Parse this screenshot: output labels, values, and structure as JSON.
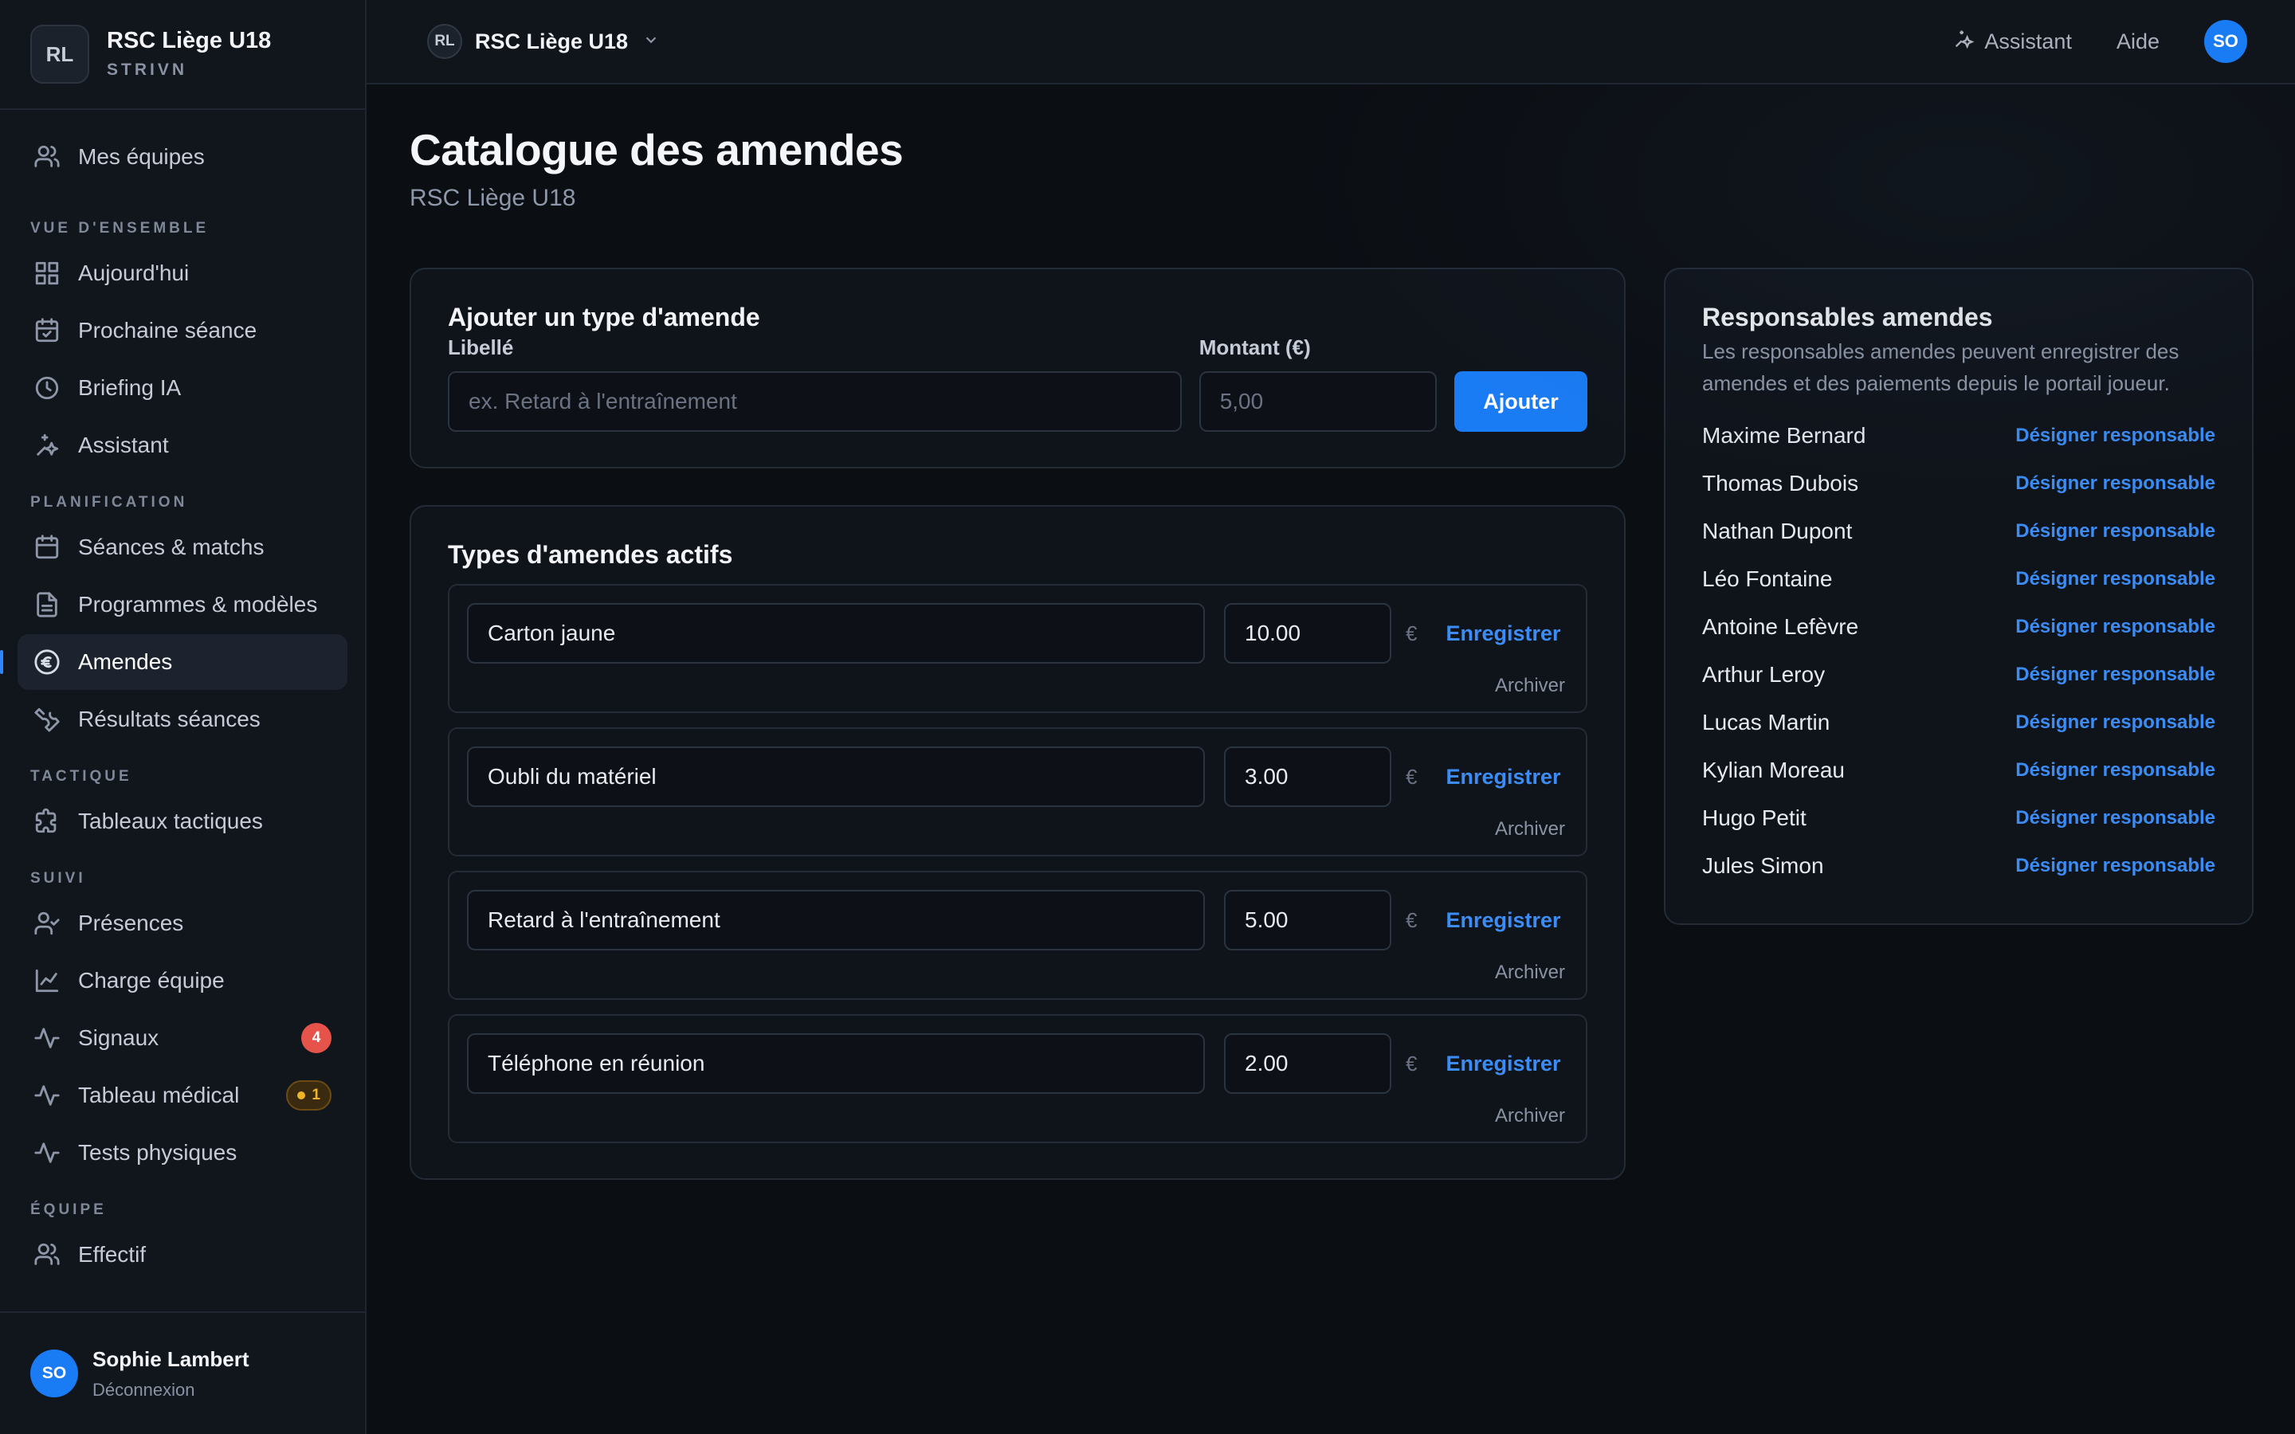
{
  "brand": {
    "initials": "RL",
    "name": "RSC Liège U18",
    "sub": "STRIVN"
  },
  "sidebar": {
    "top_item": {
      "label": "Mes équipes",
      "icon": "users-icon"
    },
    "sections": [
      {
        "label": "VUE D'ENSEMBLE",
        "items": [
          {
            "label": "Aujourd'hui",
            "icon": "grid-icon"
          },
          {
            "label": "Prochaine séance",
            "icon": "calendar-check-icon"
          },
          {
            "label": "Briefing IA",
            "icon": "clock-icon"
          },
          {
            "label": "Assistant",
            "icon": "sparkles-icon"
          }
        ]
      },
      {
        "label": "PLANIFICATION",
        "items": [
          {
            "label": "Séances & matchs",
            "icon": "calendar-icon"
          },
          {
            "label": "Programmes & modèles",
            "icon": "document-icon"
          },
          {
            "label": "Amendes",
            "icon": "euro-icon",
            "active": true
          },
          {
            "label": "Résultats séances",
            "icon": "wrench-icon"
          }
        ]
      },
      {
        "label": "TACTIQUE",
        "items": [
          {
            "label": "Tableaux tactiques",
            "icon": "puzzle-icon"
          }
        ]
      },
      {
        "label": "SUIVI",
        "items": [
          {
            "label": "Présences",
            "icon": "user-check-icon"
          },
          {
            "label": "Charge équipe",
            "icon": "line-chart-icon"
          },
          {
            "label": "Signaux",
            "icon": "activity-icon",
            "badge": "4"
          },
          {
            "label": "Tableau médical",
            "icon": "activity-icon",
            "badge_warn": "1"
          },
          {
            "label": "Tests physiques",
            "icon": "activity-icon"
          }
        ]
      },
      {
        "label": "ÉQUIPE",
        "items": [
          {
            "label": "Effectif",
            "icon": "users-icon"
          }
        ]
      }
    ]
  },
  "user": {
    "initials": "SO",
    "name": "Sophie Lambert",
    "logout": "Déconnexion"
  },
  "topbar": {
    "team_initials": "RL",
    "team_name": "RSC Liège U18",
    "assistant": "Assistant",
    "help": "Aide",
    "avatar": "SO"
  },
  "page": {
    "title": "Catalogue des amendes",
    "subtitle": "RSC Liège U18"
  },
  "add_form": {
    "title": "Ajouter un type d'amende",
    "label_field": "Libellé",
    "label_placeholder": "ex. Retard à l'entraînement",
    "amount_field": "Montant (€)",
    "amount_placeholder": "5,00",
    "submit": "Ajouter"
  },
  "active_fines": {
    "title": "Types d'amendes actifs",
    "currency": "€",
    "save_label": "Enregistrer",
    "archive_label": "Archiver",
    "items": [
      {
        "name": "Carton jaune",
        "amount": "10.00"
      },
      {
        "name": "Oubli du matériel",
        "amount": "3.00"
      },
      {
        "name": "Retard à l'entraînement",
        "amount": "5.00"
      },
      {
        "name": "Téléphone en réunion",
        "amount": "2.00"
      }
    ]
  },
  "responsables": {
    "title": "Responsables amendes",
    "description": "Les responsables amendes peuvent enregistrer des amendes et des paiements depuis le portail joueur.",
    "action_label": "Désigner responsable",
    "players": [
      "Maxime Bernard",
      "Thomas Dubois",
      "Nathan Dupont",
      "Léo Fontaine",
      "Antoine Lefèvre",
      "Arthur Leroy",
      "Lucas Martin",
      "Kylian Moreau",
      "Hugo Petit",
      "Jules Simon"
    ]
  },
  "colors": {
    "accent": "#1a7cf5",
    "link": "#3b8df5",
    "danger": "#e5534b",
    "warning": "#f0b429"
  }
}
